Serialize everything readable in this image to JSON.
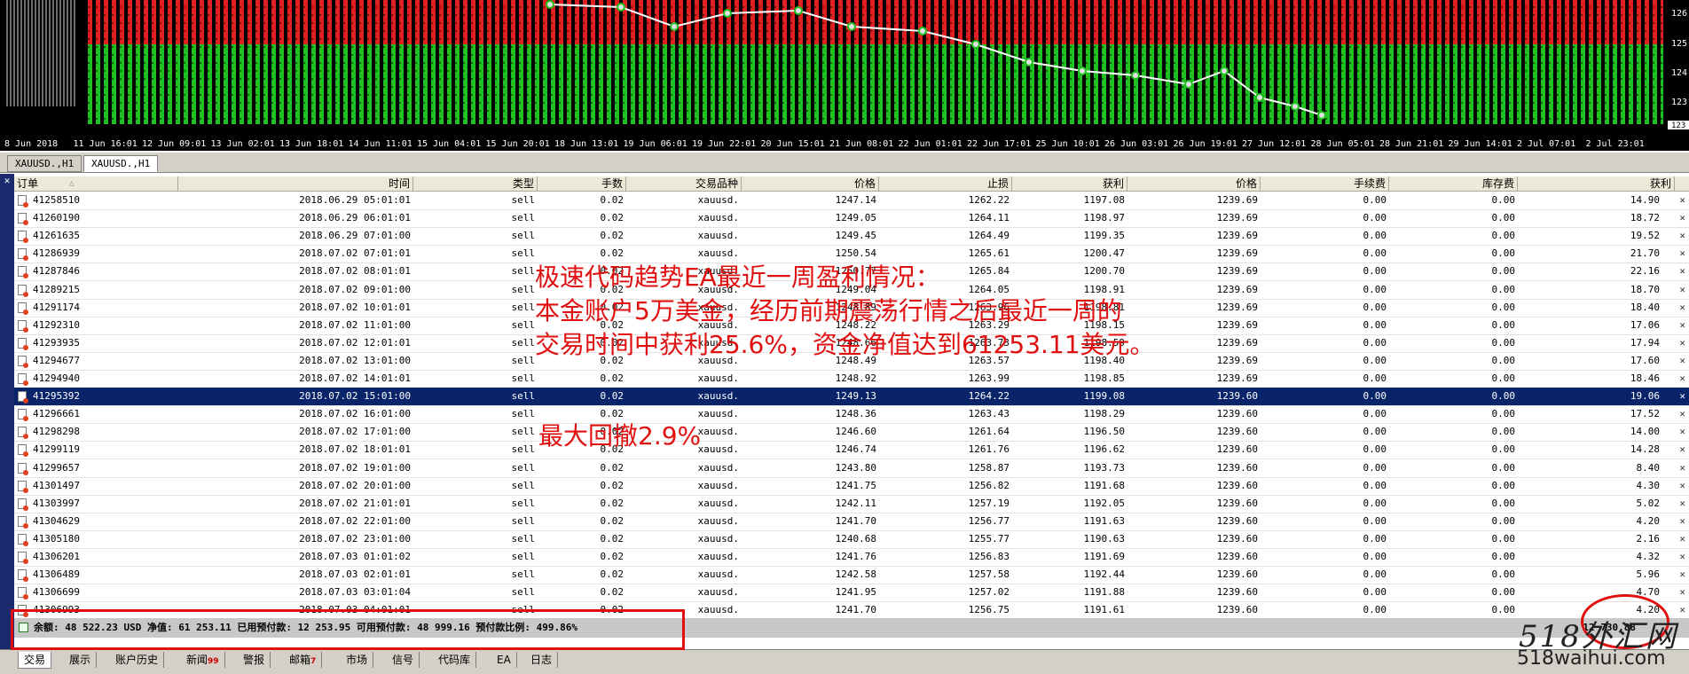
{
  "chart": {
    "price_labels": [
      "126",
      "125",
      "124",
      "123"
    ],
    "current_price": "123",
    "time_labels": [
      "8 Jun 2018",
      "11 Jun 16:01",
      "12 Jun 09:01",
      "13 Jun 02:01",
      "13 Jun 18:01",
      "14 Jun 11:01",
      "15 Jun 04:01",
      "15 Jun 20:01",
      "18 Jun 13:01",
      "19 Jun 06:01",
      "19 Jun 22:01",
      "20 Jun 15:01",
      "21 Jun 08:01",
      "22 Jun 01:01",
      "22 Jun 17:01",
      "25 Jun 10:01",
      "26 Jun 03:01",
      "26 Jun 19:01",
      "27 Jun 12:01",
      "28 Jun 05:01",
      "28 Jun 21:01",
      "29 Jun 14:01",
      "2 Jul 07:01",
      "2 Jul 23:01"
    ],
    "colors": {
      "bg": "#000000",
      "sell_zone": "#e02020",
      "buy_zone": "#20c020",
      "grid": "#404040"
    }
  },
  "chart_tabs": [
    {
      "label": "XAUUSD.,H1",
      "active": false
    },
    {
      "label": "XAUUSD.,H1",
      "active": true
    }
  ],
  "terminal": {
    "close_glyph": "✕",
    "headers": [
      "订单",
      "时间",
      "类型",
      "手数",
      "交易品种",
      "价格",
      "止损",
      "获利",
      "价格",
      "手续费",
      "库存费",
      "获利"
    ],
    "sort_glyph": "△",
    "selected_index": 11,
    "rows": [
      [
        "41258510",
        "2018.06.29 05:01:01",
        "sell",
        "0.02",
        "xauusd.",
        "1247.14",
        "1262.22",
        "1197.08",
        "1239.69",
        "0.00",
        "0.00",
        "14.90"
      ],
      [
        "41260190",
        "2018.06.29 06:01:01",
        "sell",
        "0.02",
        "xauusd.",
        "1249.05",
        "1264.11",
        "1198.97",
        "1239.69",
        "0.00",
        "0.00",
        "18.72"
      ],
      [
        "41261635",
        "2018.06.29 07:01:00",
        "sell",
        "0.02",
        "xauusd.",
        "1249.45",
        "1264.49",
        "1199.35",
        "1239.69",
        "0.00",
        "0.00",
        "19.52"
      ],
      [
        "41286939",
        "2018.07.02 07:01:01",
        "sell",
        "0.02",
        "xauusd.",
        "1250.54",
        "1265.61",
        "1200.47",
        "1239.69",
        "0.00",
        "0.00",
        "21.70"
      ],
      [
        "41287846",
        "2018.07.02 08:01:01",
        "sell",
        "0.02",
        "xauusd.",
        "1250.77",
        "1265.84",
        "1200.70",
        "1239.69",
        "0.00",
        "0.00",
        "22.16"
      ],
      [
        "41289215",
        "2018.07.02 09:01:00",
        "sell",
        "0.02",
        "xauusd.",
        "1249.04",
        "1264.05",
        "1198.91",
        "1239.69",
        "0.00",
        "0.00",
        "18.70"
      ],
      [
        "41291174",
        "2018.07.02 10:01:01",
        "sell",
        "0.02",
        "xauusd.",
        "1248.89",
        "1263.96",
        "1198.81",
        "1239.69",
        "0.00",
        "0.00",
        "18.40"
      ],
      [
        "41292310",
        "2018.07.02 11:01:00",
        "sell",
        "0.02",
        "xauusd.",
        "1248.22",
        "1263.29",
        "1198.15",
        "1239.69",
        "0.00",
        "0.00",
        "17.06"
      ],
      [
        "41293935",
        "2018.07.02 12:01:01",
        "sell",
        "0.02",
        "xauusd.",
        "1248.66",
        "1263.73",
        "1198.59",
        "1239.69",
        "0.00",
        "0.00",
        "17.94"
      ],
      [
        "41294677",
        "2018.07.02 13:01:00",
        "sell",
        "0.02",
        "xauusd.",
        "1248.49",
        "1263.57",
        "1198.40",
        "1239.69",
        "0.00",
        "0.00",
        "17.60"
      ],
      [
        "41294940",
        "2018.07.02 14:01:01",
        "sell",
        "0.02",
        "xauusd.",
        "1248.92",
        "1263.99",
        "1198.85",
        "1239.69",
        "0.00",
        "0.00",
        "18.46"
      ],
      [
        "41295392",
        "2018.07.02 15:01:00",
        "sell",
        "0.02",
        "xauusd.",
        "1249.13",
        "1264.22",
        "1199.08",
        "1239.60",
        "0.00",
        "0.00",
        "19.06"
      ],
      [
        "41296661",
        "2018.07.02 16:01:00",
        "sell",
        "0.02",
        "xauusd.",
        "1248.36",
        "1263.43",
        "1198.29",
        "1239.60",
        "0.00",
        "0.00",
        "17.52"
      ],
      [
        "41298298",
        "2018.07.02 17:01:00",
        "sell",
        "0.02",
        "xauusd.",
        "1246.60",
        "1261.64",
        "1196.50",
        "1239.60",
        "0.00",
        "0.00",
        "14.00"
      ],
      [
        "41299119",
        "2018.07.02 18:01:01",
        "sell",
        "0.02",
        "xauusd.",
        "1246.74",
        "1261.76",
        "1196.62",
        "1239.60",
        "0.00",
        "0.00",
        "14.28"
      ],
      [
        "41299657",
        "2018.07.02 19:01:00",
        "sell",
        "0.02",
        "xauusd.",
        "1243.80",
        "1258.87",
        "1193.73",
        "1239.60",
        "0.00",
        "0.00",
        "8.40"
      ],
      [
        "41301497",
        "2018.07.02 20:01:00",
        "sell",
        "0.02",
        "xauusd.",
        "1241.75",
        "1256.82",
        "1191.68",
        "1239.60",
        "0.00",
        "0.00",
        "4.30"
      ],
      [
        "41303997",
        "2018.07.02 21:01:01",
        "sell",
        "0.02",
        "xauusd.",
        "1242.11",
        "1257.19",
        "1192.05",
        "1239.60",
        "0.00",
        "0.00",
        "5.02"
      ],
      [
        "41304629",
        "2018.07.02 22:01:00",
        "sell",
        "0.02",
        "xauusd.",
        "1241.70",
        "1256.77",
        "1191.63",
        "1239.60",
        "0.00",
        "0.00",
        "4.20"
      ],
      [
        "41305180",
        "2018.07.02 23:01:00",
        "sell",
        "0.02",
        "xauusd.",
        "1240.68",
        "1255.77",
        "1190.63",
        "1239.60",
        "0.00",
        "0.00",
        "2.16"
      ],
      [
        "41306201",
        "2018.07.03 01:01:02",
        "sell",
        "0.02",
        "xauusd.",
        "1241.76",
        "1256.83",
        "1191.69",
        "1239.60",
        "0.00",
        "0.00",
        "4.32"
      ],
      [
        "41306489",
        "2018.07.03 02:01:01",
        "sell",
        "0.02",
        "xauusd.",
        "1242.58",
        "1257.58",
        "1192.44",
        "1239.60",
        "0.00",
        "0.00",
        "5.96"
      ],
      [
        "41306699",
        "2018.07.03 03:01:04",
        "sell",
        "0.02",
        "xauusd.",
        "1241.95",
        "1257.02",
        "1191.88",
        "1239.60",
        "0.00",
        "0.00",
        "4.70"
      ],
      [
        "41306993",
        "2018.07.03 04:01:01",
        "sell",
        "0.02",
        "xauusd.",
        "1241.70",
        "1256.75",
        "1191.61",
        "1239.60",
        "0.00",
        "0.00",
        "4.20"
      ]
    ],
    "summary": "余额: 48 522.23 USD  净值: 61 253.11  已用预付款: 12 253.95  可用预付款: 48 999.16  预付款比例: 499.86%",
    "summary_total": "12 730.88"
  },
  "bottom_tabs": [
    {
      "label": "交易",
      "active": true,
      "badge": ""
    },
    {
      "label": "展示",
      "active": false,
      "badge": ""
    },
    {
      "label": "账户历史",
      "active": false,
      "badge": ""
    },
    {
      "label": "新闻",
      "active": false,
      "badge": "99"
    },
    {
      "label": "警报",
      "active": false,
      "badge": ""
    },
    {
      "label": "邮箱",
      "active": false,
      "badge": "7"
    },
    {
      "label": "市场",
      "active": false,
      "badge": ""
    },
    {
      "label": "信号",
      "active": false,
      "badge": ""
    },
    {
      "label": "代码库",
      "active": false,
      "badge": ""
    },
    {
      "label": "EA",
      "active": false,
      "badge": ""
    },
    {
      "label": "日志",
      "active": false,
      "badge": ""
    }
  ],
  "annotation": {
    "line1": "极速代码趋势EA最近一周盈利情况：",
    "line2": "本金账户5万美金，经历前期震荡行情之后最近一周的",
    "line3": "交易时间中获利25.6%，资金净值达到61253.11美元。",
    "line4": "最大回撤2.9%"
  },
  "watermark": {
    "logo": "518外汇网",
    "url": "518waihui.com"
  }
}
